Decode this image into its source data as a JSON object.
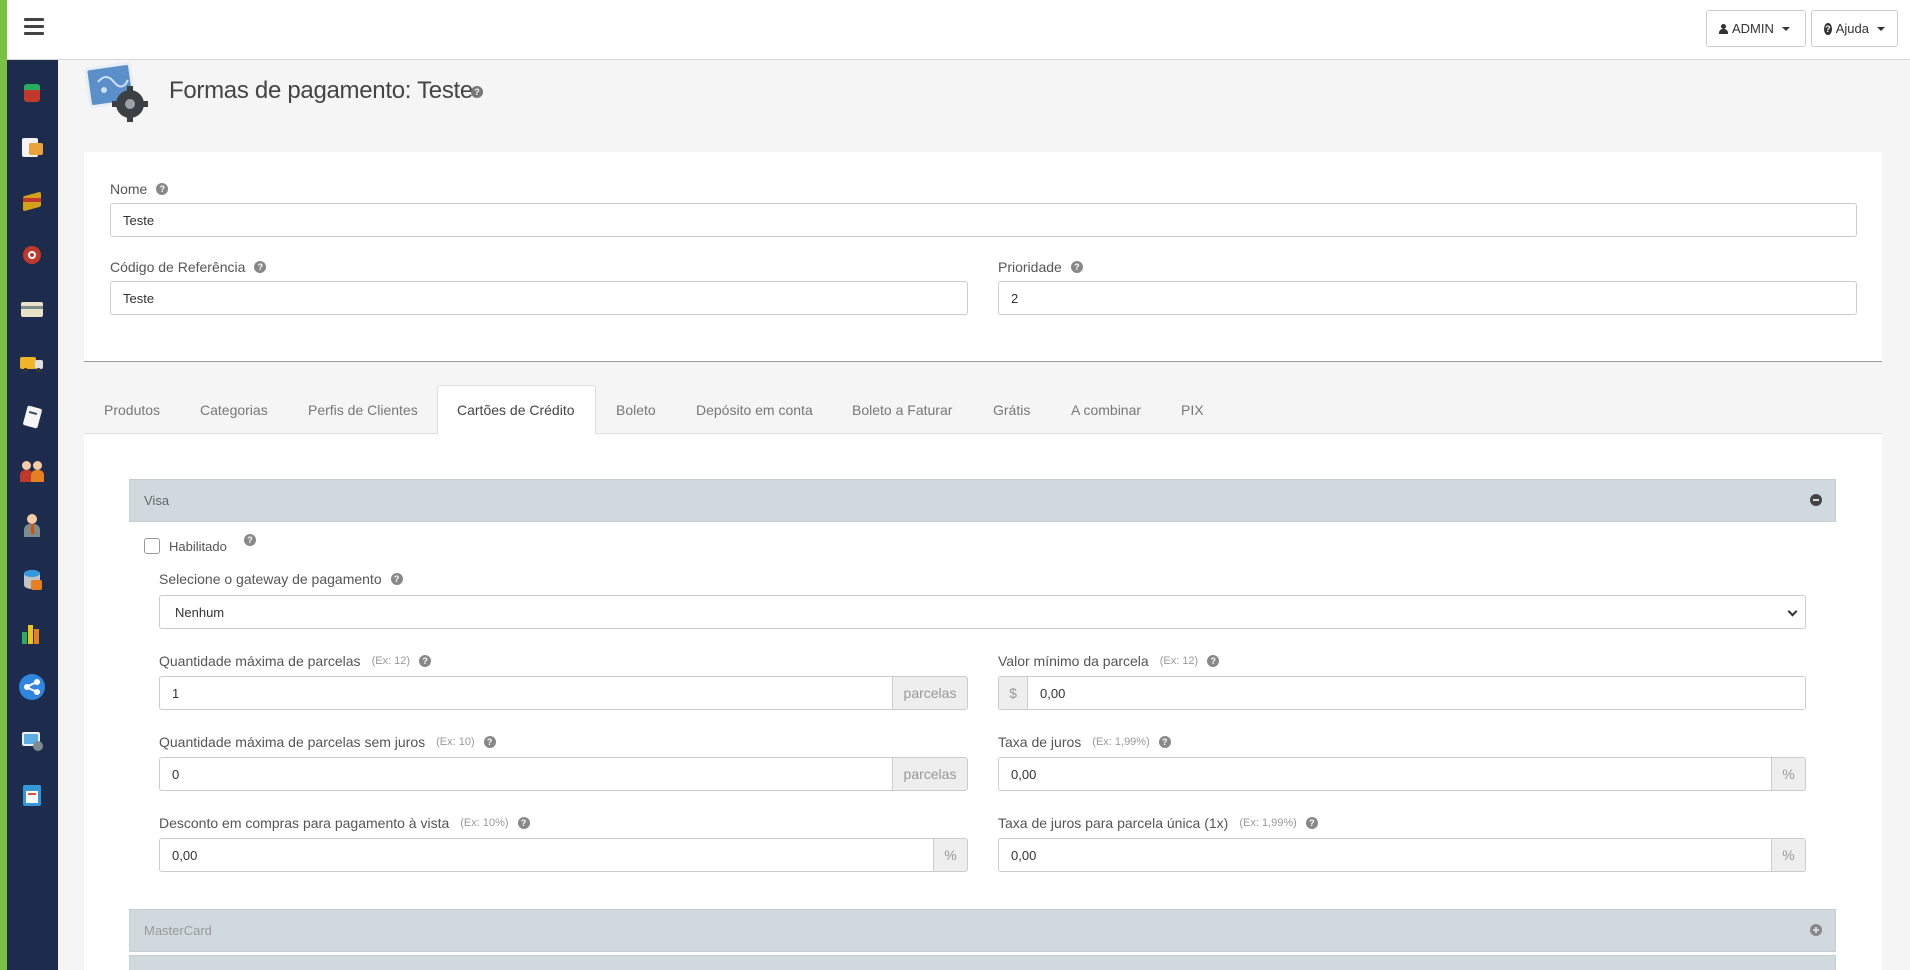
{
  "topbar": {
    "admin_label": "ADMIN",
    "help_label": "Ajuda"
  },
  "sidebar": {
    "items": [
      {
        "icon": "products-icon",
        "color": "#c0392b"
      },
      {
        "icon": "catalog-icon",
        "color": "#e8a33d"
      },
      {
        "icon": "package-icon",
        "color": "#d4a017"
      },
      {
        "icon": "promotions-icon",
        "color": "#c0392b"
      },
      {
        "icon": "credit-card-icon",
        "color": "#e9e2c4"
      },
      {
        "icon": "shipping-truck-icon",
        "color": "#f0b429"
      },
      {
        "icon": "document-icon",
        "color": "#f5f5f5"
      },
      {
        "icon": "customers-icon",
        "color": "#e67e22"
      },
      {
        "icon": "user-icon",
        "color": "#d35400"
      },
      {
        "icon": "database-icon",
        "color": "#3498db"
      },
      {
        "icon": "reports-chart-icon",
        "color": "#27ae60"
      },
      {
        "icon": "share-icon",
        "color": "#2e86de"
      },
      {
        "icon": "settings-screen-icon",
        "color": "#5dade2"
      },
      {
        "icon": "calendar-icon",
        "color": "#3498db"
      }
    ]
  },
  "page": {
    "title": "Formas de pagamento: Teste"
  },
  "form": {
    "nome_label": "Nome",
    "nome_value": "Teste",
    "codigo_label": "Código de Referência",
    "codigo_value": "Teste",
    "prioridade_label": "Prioridade",
    "prioridade_value": "2"
  },
  "tabs": [
    {
      "label": "Produtos"
    },
    {
      "label": "Categorias"
    },
    {
      "label": "Perfis de Clientes"
    },
    {
      "label": "Cartões de Crédito",
      "active": true
    },
    {
      "label": "Boleto"
    },
    {
      "label": "Depósito em conta"
    },
    {
      "label": "Boleto a Faturar"
    },
    {
      "label": "Grátis"
    },
    {
      "label": "A combinar"
    },
    {
      "label": "PIX"
    }
  ],
  "visa": {
    "title": "Visa",
    "enabled_label": "Habilitado",
    "gateway_label": "Selecione o gateway de pagamento",
    "gateway_value": "Nenhum",
    "max_parcelas_label": "Quantidade máxima de parcelas",
    "max_parcelas_hint": "(Ex: 12)",
    "max_parcelas_value": "1",
    "parcelas_addon": "parcelas",
    "min_parcela_label": "Valor mínimo da parcela",
    "min_parcela_hint": "(Ex: 12)",
    "currency_addon": "$",
    "min_parcela_value": "0,00",
    "sem_juros_label": "Quantidade máxima de parcelas sem juros",
    "sem_juros_hint": "(Ex: 10)",
    "sem_juros_value": "0",
    "taxa_label": "Taxa de juros",
    "taxa_hint": "(Ex: 1,99%)",
    "taxa_value": "0,00",
    "percent_addon": "%",
    "desconto_label": "Desconto em compras para pagamento à vista",
    "desconto_hint": "(Ex: 10%)",
    "desconto_value": "0,00",
    "taxa_unica_label": "Taxa de juros para parcela única (1x)",
    "taxa_unica_hint": "(Ex: 1,99%)",
    "taxa_unica_value": "0,00"
  },
  "mastercard": {
    "title": "MasterCard"
  }
}
